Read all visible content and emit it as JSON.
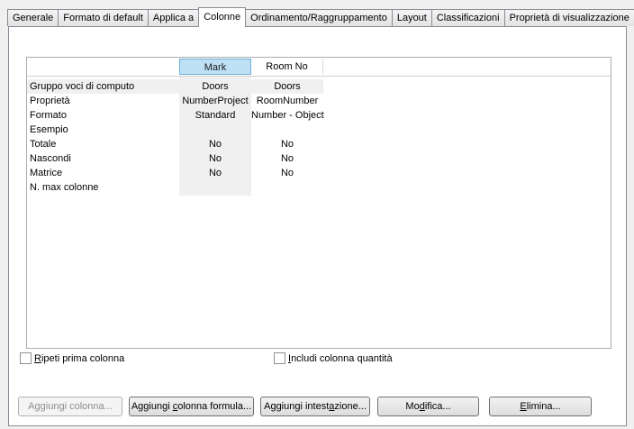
{
  "tabs": [
    {
      "label": "Generale"
    },
    {
      "label": "Formato di default"
    },
    {
      "label": "Applica a"
    },
    {
      "label": "Colonne",
      "active": true
    },
    {
      "label": "Ordinamento/Raggruppamento"
    },
    {
      "label": "Layout"
    },
    {
      "label": "Classificazioni"
    },
    {
      "label": "Proprietà di visualizzazione"
    }
  ],
  "grid": {
    "columns": [
      "Mark",
      "Room No"
    ],
    "rows": [
      {
        "label": "Gruppo voci di computo",
        "values": [
          "Doors",
          "Doors"
        ]
      },
      {
        "label": "Proprietà",
        "values": [
          "NumberProject",
          "RoomNumber"
        ]
      },
      {
        "label": "Formato",
        "values": [
          "Standard",
          "Number - Object"
        ]
      },
      {
        "label": "Esempio",
        "values": [
          "",
          ""
        ]
      },
      {
        "label": "Totale",
        "values": [
          "No",
          "No"
        ]
      },
      {
        "label": "Nascondi",
        "values": [
          "No",
          "No"
        ]
      },
      {
        "label": "Matrice",
        "values": [
          "No",
          "No"
        ]
      },
      {
        "label": "N. max colonne",
        "values": [
          "",
          ""
        ]
      }
    ]
  },
  "options": {
    "repeat_first_column": {
      "mnemonic": "R",
      "rest": "ipeti prima colonna",
      "checked": false
    },
    "include_quantity_column": {
      "mnemonic": "I",
      "rest": "ncludi colonna quantità",
      "checked": false
    }
  },
  "buttons": {
    "add_column": "Aggiungi colonna...",
    "add_formula_a": "Aggiungi ",
    "add_formula_m": "c",
    "add_formula_b": "olonna formula...",
    "add_header_a": "Aggiungi intest",
    "add_header_m": "a",
    "add_header_b": "zione...",
    "modify_a": "Mo",
    "modify_m": "d",
    "modify_b": "ifica...",
    "delete_m": "E",
    "delete_b": "limina..."
  }
}
